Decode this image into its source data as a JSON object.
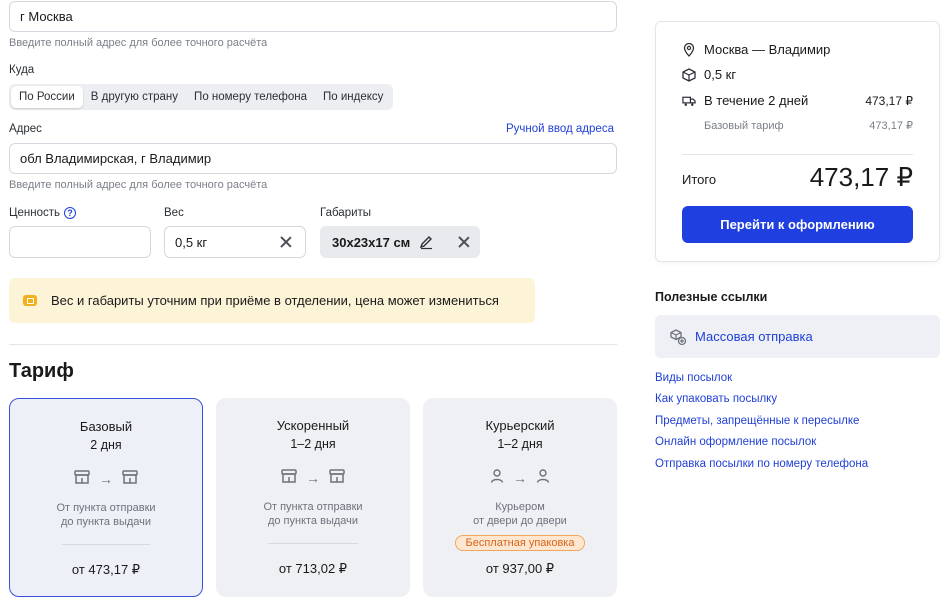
{
  "from_field": {
    "value": "г Москва",
    "hint": "Введите полный адрес для более точного расчёта"
  },
  "to": {
    "label": "Куда",
    "tabs": [
      "По России",
      "В другую страну",
      "По номеру телефона",
      "По индексу"
    ],
    "active_tab": "По России"
  },
  "address": {
    "label": "Адрес",
    "manual_link": "Ручной ввод адреса",
    "value": "обл Владимирская, г Владимир",
    "hint": "Введите полный адрес для более точного расчёта"
  },
  "parcel": {
    "value_label": "Ценность",
    "value_input": "",
    "weight_label": "Вес",
    "weight_value": "0,5 кг",
    "size_label": "Габариты",
    "size_value": "30х23х17 см"
  },
  "notice": {
    "text": "Вес и габариты уточним при приёме в отделении, цена может измениться"
  },
  "tariff": {
    "heading": "Тариф",
    "cards": [
      {
        "name": "Базовый",
        "days": "2 дня",
        "desc1": "От пункта отправки",
        "desc2": "до пункта выдачи",
        "price": "от 473,17 ₽",
        "selected": true
      },
      {
        "name": "Ускоренный",
        "days": "1–2 дня",
        "desc1": "От пункта отправки",
        "desc2": "до пункта выдачи",
        "price": "от 713,02 ₽",
        "selected": false
      },
      {
        "name": "Курьерский",
        "days": "1–2 дня",
        "desc1": "Курьером",
        "desc2": "от двери до двери",
        "badge": "Бесплатная упаковка",
        "price": "от 937,00 ₽",
        "selected": false
      }
    ]
  },
  "summary": {
    "route": "Москва — Владимир",
    "weight": "0,5 кг",
    "delivery": "В течение 2 дней",
    "delivery_price": "473,17 ₽",
    "tariff_name": "Базовый тариф",
    "tariff_price": "473,17 ₽",
    "total_label": "Итого",
    "total": "473,17 ₽",
    "cta": "Перейти к оформлению"
  },
  "useful": {
    "heading": "Полезные ссылки",
    "mass_sending": "Массовая отправка",
    "links": [
      "Виды посылок",
      "Как упаковать посылку",
      "Предметы, запрещённые к пересылке",
      "Онлайн оформление посылок",
      "Отправка посылки по номеру телефона"
    ]
  },
  "colors": {
    "accent": "#1f3fe0",
    "link": "#1f3fd6",
    "notice_bg": "#fdf3d6",
    "badge": "#d9651b"
  }
}
